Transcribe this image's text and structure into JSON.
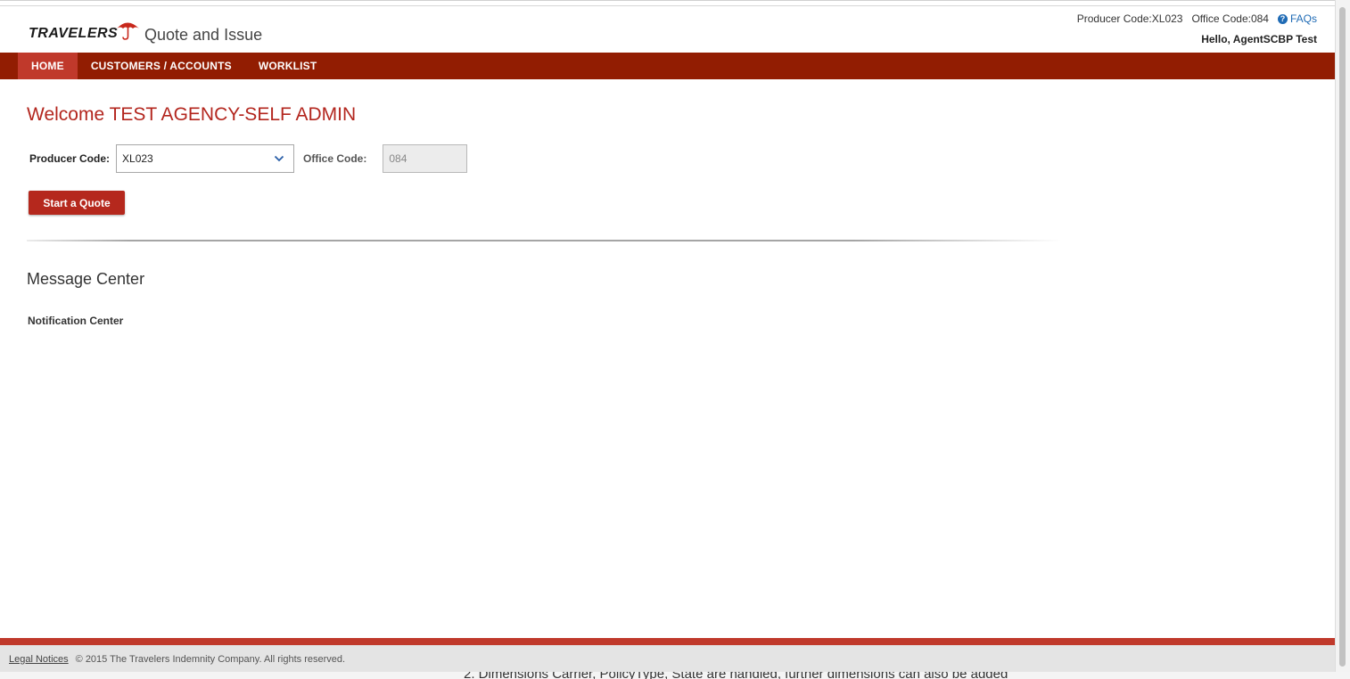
{
  "header": {
    "brand": "TRAVELERS",
    "app_title": "Quote and Issue",
    "producer_code": "Producer Code:XL023",
    "office_code": "Office Code:084",
    "faqs": "FAQs",
    "greeting": "Hello, AgentSCBP Test"
  },
  "nav": {
    "items": [
      {
        "label": "HOME",
        "active": true
      },
      {
        "label": "CUSTOMERS / ACCOUNTS",
        "active": false
      },
      {
        "label": "WORKLIST",
        "active": false
      }
    ]
  },
  "main": {
    "welcome": "Welcome TEST AGENCY-SELF ADMIN",
    "producer_code_label": "Producer Code:",
    "producer_code_value": "XL023",
    "office_code_label": "Office Code:",
    "office_code_value": "084",
    "start_quote": "Start a Quote",
    "message_center": "Message Center",
    "notification_center": "Notification Center"
  },
  "footer": {
    "legal": "Legal Notices",
    "copyright": "© 2015 The Travelers Indemnity Company. All rights reserved."
  },
  "background": {
    "partial_text": "2. Dimensions Carrier, PolicyType, State are handled, further dimensions can also be added"
  },
  "colors": {
    "brand_red": "#921d02",
    "accent_red": "#b3261e",
    "link_blue": "#1f6bb5"
  }
}
